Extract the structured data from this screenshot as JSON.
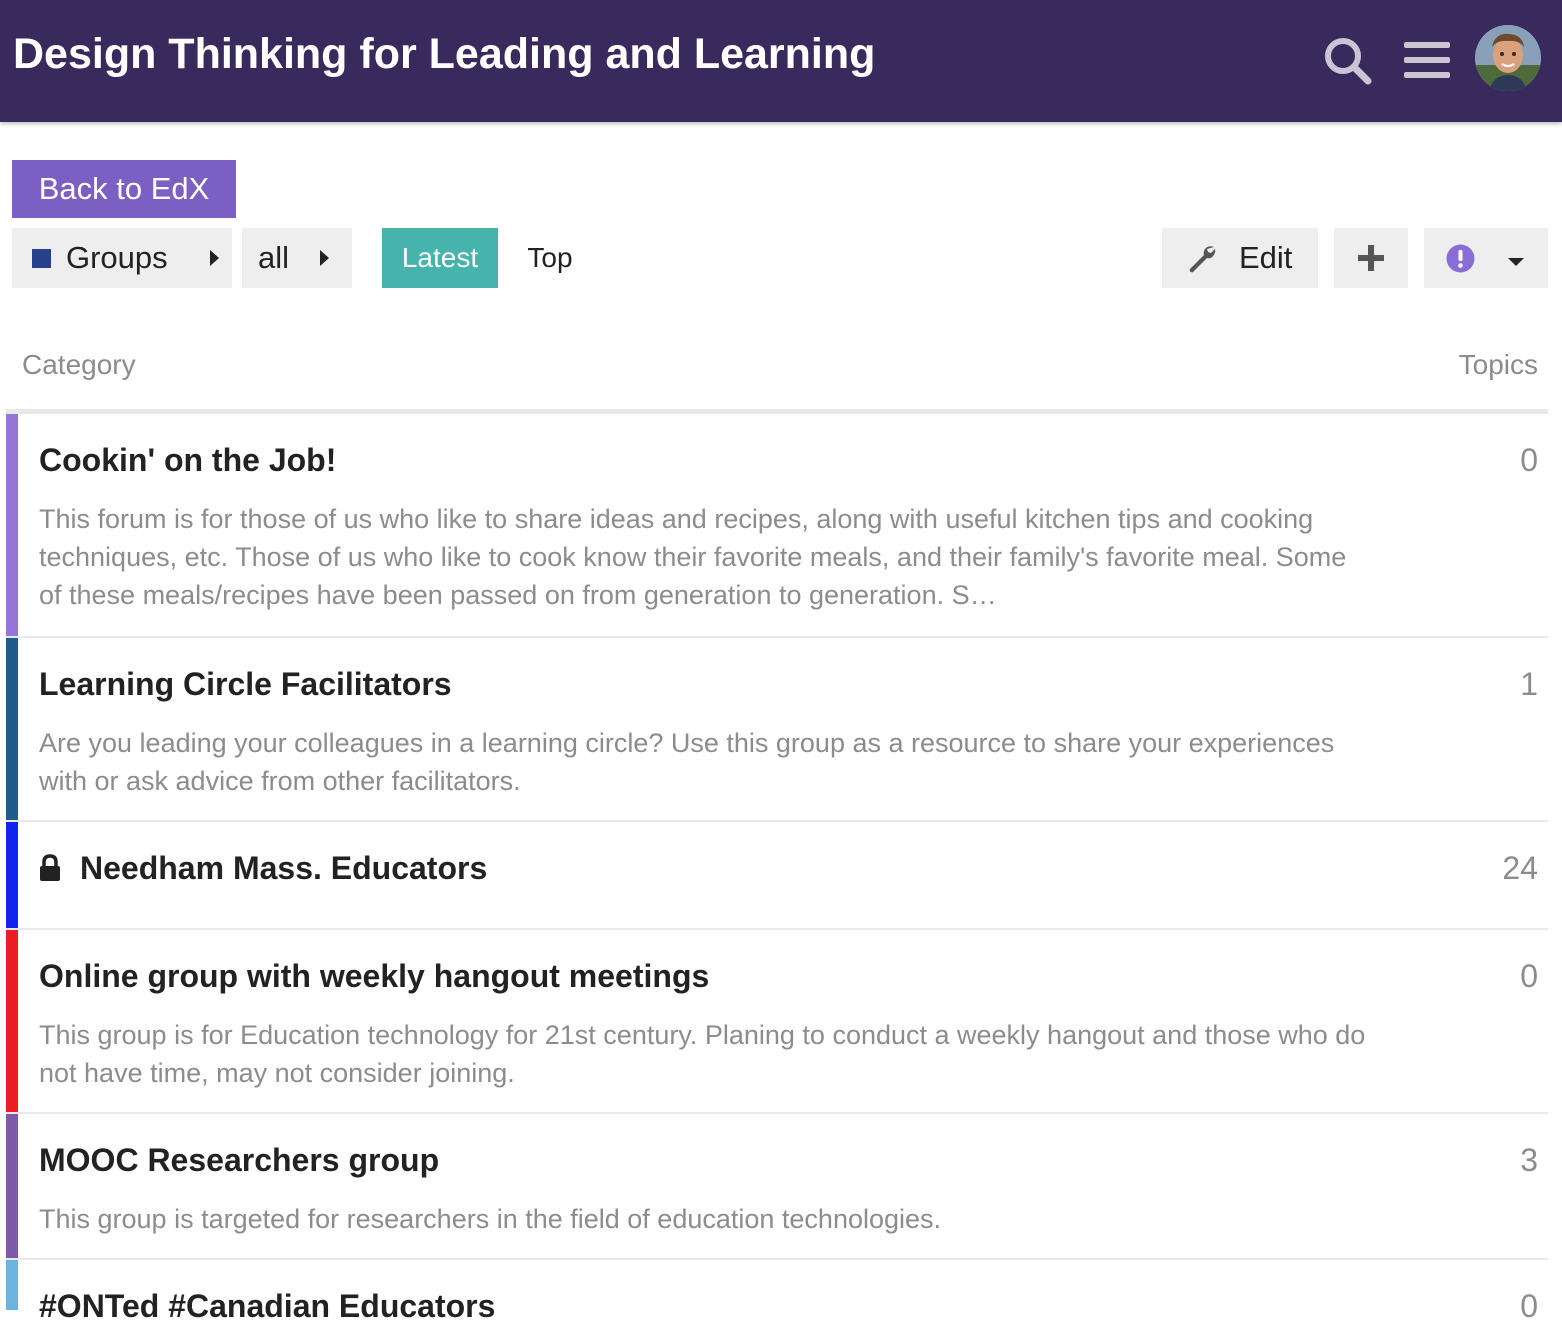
{
  "header": {
    "title": "Design Thinking for Leading and Learning",
    "icons": [
      "search-icon",
      "hamburger-menu-icon",
      "user-avatar"
    ],
    "background_color": "#382a5c"
  },
  "back_button": {
    "label": "Back to EdX",
    "color": "#7b5fc2"
  },
  "nav": {
    "breadcrumb_category": "Groups",
    "breadcrumb_category_color": "#283f8c",
    "breadcrumb_subcategory": "all",
    "tabs": [
      {
        "label": "Latest",
        "active": true
      },
      {
        "label": "Top",
        "active": false
      }
    ],
    "active_color": "#47b3ad",
    "edit_label": "Edit"
  },
  "table": {
    "col_category": "Category",
    "col_topics": "Topics",
    "rows": [
      {
        "name": "Cookin' on the Job!",
        "description": "This forum is for those of us who like to share ideas and recipes, along with useful kitchen tips and cooking techniques, etc. Those of us who like to cook know their favorite meals, and their family's favorite meal. Some of these meals/recipes have been passed on from generation to generation. S…",
        "topics": "0",
        "color": "#9575d8",
        "locked": false
      },
      {
        "name": "Learning Circle Facilitators",
        "description": "Are you leading your colleagues in a learning circle? Use this group as a resource to share your experiences with or ask advice from other facilitators.",
        "topics": "1",
        "color": "#1d5c8a",
        "locked": false
      },
      {
        "name": "Needham Mass. Educators",
        "description": "",
        "topics": "24",
        "color": "#1523f0",
        "locked": true
      },
      {
        "name": "Online group with weekly hangout meetings",
        "description": "This group is for Education technology for 21st century. Planing to conduct a weekly hangout and those who do not have time, may not consider joining.",
        "topics": "0",
        "color": "#ec1c24",
        "locked": false
      },
      {
        "name": "MOOC Researchers group",
        "description": "This group is targeted for researchers in the field of education technologies.",
        "topics": "3",
        "color": "#7e59a8",
        "locked": false
      },
      {
        "name": "#ONTed #Canadian Educators",
        "description": "",
        "topics": "0",
        "color": "#6cb3e0",
        "locked": false
      }
    ]
  }
}
